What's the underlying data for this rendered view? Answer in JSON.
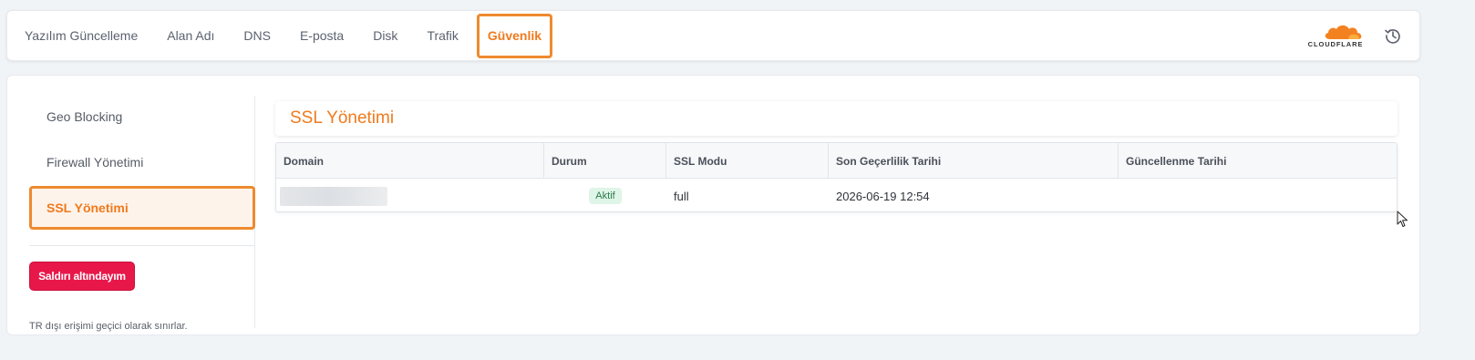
{
  "nav": {
    "tabs": [
      {
        "label": "Yazılım Güncelleme"
      },
      {
        "label": "Alan Adı"
      },
      {
        "label": "DNS"
      },
      {
        "label": "E-posta"
      },
      {
        "label": "Disk"
      },
      {
        "label": "Trafik"
      },
      {
        "label": "Güvenlik"
      }
    ],
    "active_tab": "Güvenlik",
    "brand_logo": "CLOUDFLARE",
    "history_icon": "history-icon"
  },
  "sidebar": {
    "items": [
      {
        "label": "Geo Blocking"
      },
      {
        "label": "Firewall Yönetimi"
      },
      {
        "label": "SSL Yönetimi"
      }
    ],
    "active_item": "SSL Yönetimi",
    "attack_button": "Saldırı altındayım",
    "attack_note": "TR dışı erişimi geçici olarak sınırlar."
  },
  "ssl": {
    "title": "SSL Yönetimi",
    "columns": [
      "Domain",
      "Durum",
      "SSL Modu",
      "Son Geçerlilik Tarihi",
      "Güncellenme Tarihi"
    ],
    "rows": [
      {
        "domain": "",
        "status": "Aktif",
        "ssl_mode": "full",
        "expiry": "2026-06-19 12:54",
        "updated": ""
      }
    ]
  },
  "colors": {
    "accent": "#f07a1d",
    "highlight_border": "#ee8a2f",
    "danger": "#e8174a",
    "success_bg": "#dff5e8",
    "success_text": "#2b7a4c"
  }
}
